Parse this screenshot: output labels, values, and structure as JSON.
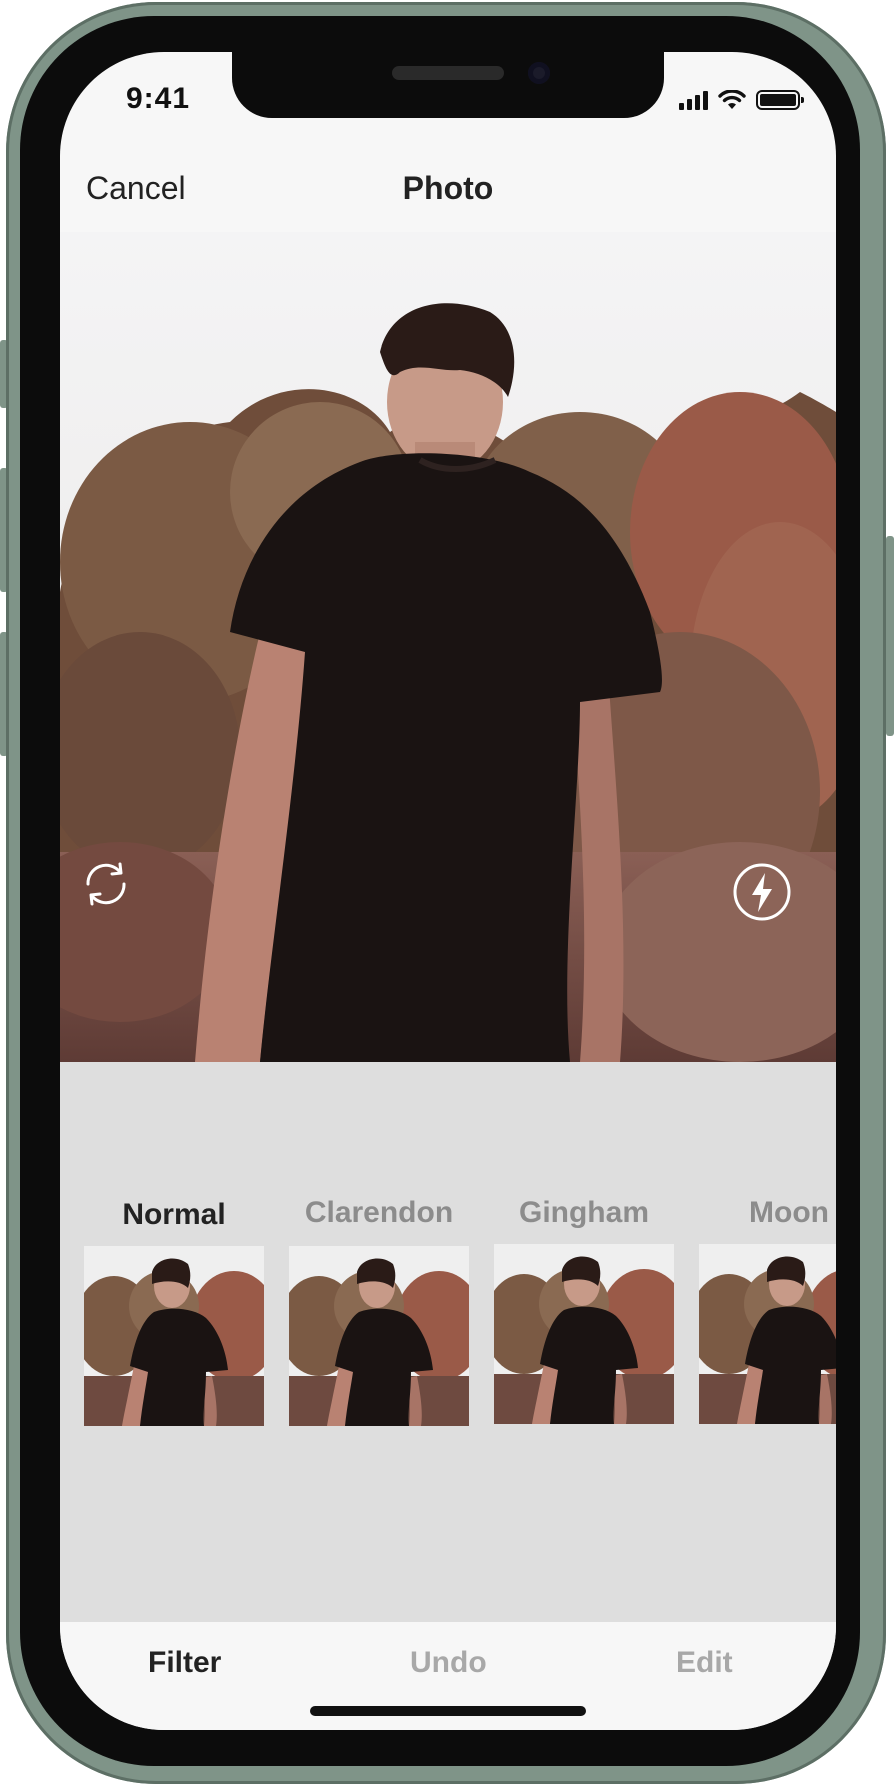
{
  "status_bar": {
    "time": "9:41",
    "icons": [
      "cellular-signal-icon",
      "wifi-icon",
      "battery-icon"
    ]
  },
  "nav": {
    "cancel_label": "Cancel",
    "title": "Photo"
  },
  "photo": {
    "controls": [
      "switch-camera-icon",
      "flash-icon"
    ]
  },
  "filters": {
    "selected": "Normal",
    "items": [
      {
        "label": "Normal"
      },
      {
        "label": "Clarendon"
      },
      {
        "label": "Gingham"
      },
      {
        "label": "Moon"
      }
    ]
  },
  "tabs": [
    {
      "label": "Filter",
      "active": true
    },
    {
      "label": "Undo",
      "active": false
    },
    {
      "label": "Edit",
      "active": false
    }
  ],
  "colors": {
    "frame": "#7f9488",
    "filter_area_bg": "#dedede",
    "active_text": "#222222",
    "inactive_text": "#8c8c8c"
  }
}
